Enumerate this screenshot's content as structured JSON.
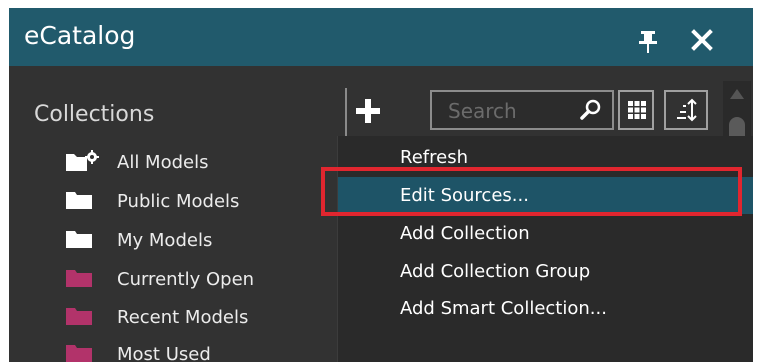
{
  "window": {
    "title": "eCatalog",
    "pin_icon": "pin-icon",
    "close_icon": "close-icon"
  },
  "sidebar": {
    "heading": "Collections",
    "items": [
      {
        "label": "All Models",
        "icon": "folder-settings-icon",
        "color": "#ffffff"
      },
      {
        "label": "Public Models",
        "icon": "folder-icon",
        "color": "#ffffff"
      },
      {
        "label": "My Models",
        "icon": "folder-icon",
        "color": "#ffffff"
      },
      {
        "label": "Currently Open",
        "icon": "folder-icon",
        "color": "#b2336a"
      },
      {
        "label": "Recent Models",
        "icon": "folder-icon",
        "color": "#b2336a"
      },
      {
        "label": "Most Used",
        "icon": "folder-icon",
        "color": "#b2336a"
      }
    ]
  },
  "toolbar": {
    "add_icon": "plus-icon",
    "search_placeholder": "Search",
    "search_icon": "search-icon",
    "grid_icon": "grid-view-icon",
    "sort_icon": "sort-icon"
  },
  "context_menu": {
    "items": [
      {
        "label": "Refresh",
        "selected": false
      },
      {
        "label": "Edit Sources...",
        "selected": true
      },
      {
        "label": "Add Collection",
        "selected": false
      },
      {
        "label": "Add Collection Group",
        "selected": false
      },
      {
        "label": "Add Smart Collection...",
        "selected": false
      }
    ],
    "highlight_color": "#e1262f",
    "selected_bg": "#1e5467"
  },
  "colors": {
    "titlebar": "#215a6c",
    "panel_bg": "#323232",
    "accent_folder": "#b2336a"
  }
}
